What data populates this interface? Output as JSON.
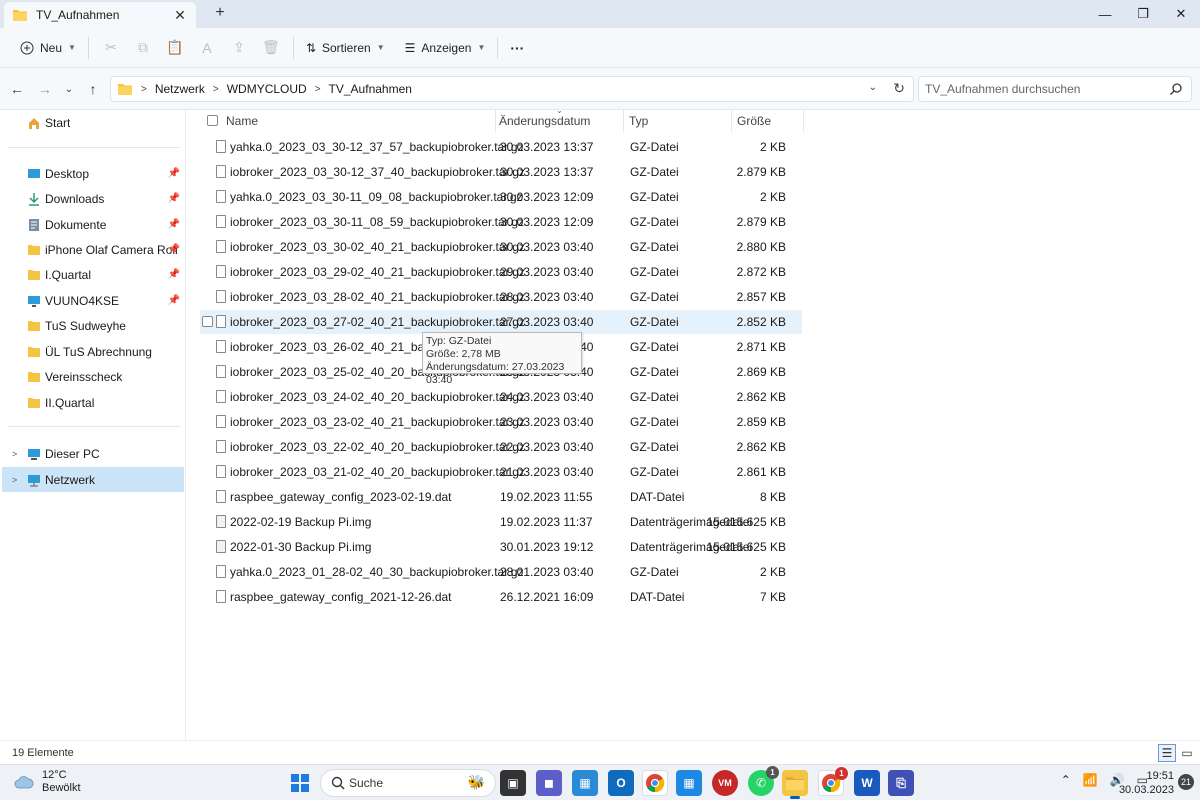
{
  "window": {
    "tab_title": "TV_Aufnahmen",
    "new_tab": "+",
    "minimize": "—",
    "maximize": "❐",
    "close": "✕"
  },
  "commandbar": {
    "new_label": "Neu",
    "sort_label": "Sortieren",
    "view_label": "Anzeigen",
    "more_label": "···"
  },
  "address": {
    "crumbs": [
      "Netzwerk",
      "WDMYCLOUD",
      "TV_Aufnahmen"
    ],
    "search_placeholder": "TV_Aufnahmen durchsuchen"
  },
  "sidebar": {
    "start": "Start",
    "quick": [
      {
        "label": "Desktop",
        "icon": "desktop-icon"
      },
      {
        "label": "Downloads",
        "icon": "download-icon"
      },
      {
        "label": "Dokumente",
        "icon": "document-icon"
      },
      {
        "label": "iPhone Olaf Camera Roll Backup",
        "icon": "folder-icon"
      },
      {
        "label": "I.Quartal",
        "icon": "folder-icon"
      },
      {
        "label": "VUUNO4KSE",
        "icon": "monitor-icon"
      },
      {
        "label": "TuS Sudweyhe",
        "icon": "folder-icon"
      },
      {
        "label": "ÜL TuS Abrechnung",
        "icon": "folder-icon"
      },
      {
        "label": "Vereinsscheck",
        "icon": "folder-icon"
      },
      {
        "label": "II.Quartal",
        "icon": "folder-icon"
      }
    ],
    "this_pc": "Dieser PC",
    "network": "Netzwerk"
  },
  "columns": {
    "name": "Name",
    "date": "Änderungsdatum",
    "type": "Typ",
    "size": "Größe"
  },
  "files": [
    {
      "name": "yahka.0_2023_03_30-12_37_57_backupiobroker.tar.gz",
      "date": "30.03.2023 13:37",
      "type": "GZ-Datei",
      "size": "2 KB"
    },
    {
      "name": "iobroker_2023_03_30-12_37_40_backupiobroker.tar.gz",
      "date": "30.03.2023 13:37",
      "type": "GZ-Datei",
      "size": "2.879 KB"
    },
    {
      "name": "yahka.0_2023_03_30-11_09_08_backupiobroker.tar.gz",
      "date": "30.03.2023 12:09",
      "type": "GZ-Datei",
      "size": "2 KB"
    },
    {
      "name": "iobroker_2023_03_30-11_08_59_backupiobroker.tar.gz",
      "date": "30.03.2023 12:09",
      "type": "GZ-Datei",
      "size": "2.879 KB"
    },
    {
      "name": "iobroker_2023_03_30-02_40_21_backupiobroker.tar.gz",
      "date": "30.03.2023 03:40",
      "type": "GZ-Datei",
      "size": "2.880 KB"
    },
    {
      "name": "iobroker_2023_03_29-02_40_21_backupiobroker.tar.gz",
      "date": "29.03.2023 03:40",
      "type": "GZ-Datei",
      "size": "2.872 KB"
    },
    {
      "name": "iobroker_2023_03_28-02_40_21_backupiobroker.tar.gz",
      "date": "28.03.2023 03:40",
      "type": "GZ-Datei",
      "size": "2.857 KB"
    },
    {
      "name": "iobroker_2023_03_27-02_40_21_backupiobroker.tar.gz",
      "date": "27.03.2023 03:40",
      "type": "GZ-Datei",
      "size": "2.852 KB"
    },
    {
      "name": "iobroker_2023_03_26-02_40_21_backupiobro",
      "date": "26.03.2023 03:40",
      "type": "GZ-Datei",
      "size": "2.871 KB"
    },
    {
      "name": "iobroker_2023_03_25-02_40_20_backupiobroker.tar.gz",
      "date": "25.03.2023 03:40",
      "type": "GZ-Datei",
      "size": "2.869 KB"
    },
    {
      "name": "iobroker_2023_03_24-02_40_20_backupiobroker.tar.gz",
      "date": "24.03.2023 03:40",
      "type": "GZ-Datei",
      "size": "2.862 KB"
    },
    {
      "name": "iobroker_2023_03_23-02_40_21_backupiobroker.tar.gz",
      "date": "23.03.2023 03:40",
      "type": "GZ-Datei",
      "size": "2.859 KB"
    },
    {
      "name": "iobroker_2023_03_22-02_40_20_backupiobroker.tar.gz",
      "date": "22.03.2023 03:40",
      "type": "GZ-Datei",
      "size": "2.862 KB"
    },
    {
      "name": "iobroker_2023_03_21-02_40_20_backupiobroker.tar.gz",
      "date": "21.03.2023 03:40",
      "type": "GZ-Datei",
      "size": "2.861 KB"
    },
    {
      "name": "raspbee_gateway_config_2023-02-19.dat",
      "date": "19.02.2023 11:55",
      "type": "DAT-Datei",
      "size": "8 KB"
    },
    {
      "name": "2022-02-19 Backup Pi.img",
      "date": "19.02.2023 11:37",
      "type": "Datenträgerimagedatei",
      "size": "15.015.625 KB"
    },
    {
      "name": "2022-01-30 Backup Pi.img",
      "date": "30.01.2023 19:12",
      "type": "Datenträgerimagedatei",
      "size": "15.015.625 KB"
    },
    {
      "name": "yahka.0_2023_01_28-02_40_30_backupiobroker.tar.gz",
      "date": "28.01.2023 03:40",
      "type": "GZ-Datei",
      "size": "2 KB"
    },
    {
      "name": "raspbee_gateway_config_2021-12-26.dat",
      "date": "26.12.2021 16:09",
      "type": "DAT-Datei",
      "size": "7 KB"
    }
  ],
  "tooltip": {
    "line1": "Typ: GZ-Datei",
    "line2": "Größe: 2,78 MB",
    "line3": "Änderungsdatum: 27.03.2023 03:40"
  },
  "status": {
    "count": "19 Elemente"
  },
  "taskbar": {
    "temp": "12°C",
    "weather": "Bewölkt",
    "search": "Suche",
    "whatsapp_badge": "1",
    "chrome_badge": "1",
    "vm_label": "VM",
    "word_label": "W",
    "time": "19:51",
    "date": "30.03.2023",
    "notifications": "21"
  },
  "colors": {
    "accent": "#005fb8",
    "folder": "#f4c542",
    "hover": "#e5f1fb",
    "selected": "#cce4f7"
  }
}
